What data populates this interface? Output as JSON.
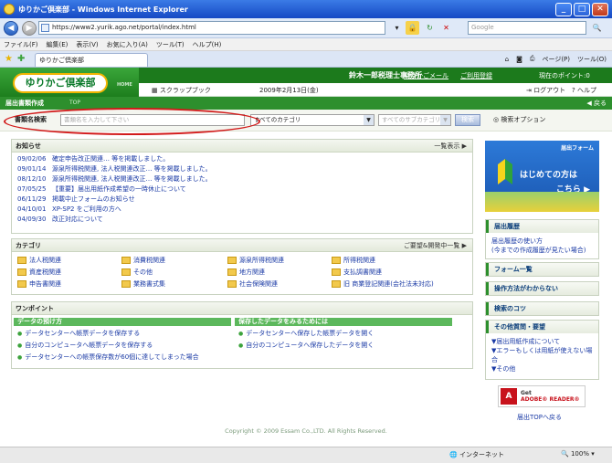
{
  "window": {
    "title": "ゆりかご倶楽部 - Windows Internet Explorer",
    "url": "https://www2.yurik.ago.net/portal/index.html",
    "search_placeholder": "Google"
  },
  "menu": [
    "ファイル(F)",
    "編集(E)",
    "表示(V)",
    "お気に入り(A)",
    "ツール(T)",
    "ヘルプ(H)"
  ],
  "tab": {
    "label": "ゆりかご倶楽部"
  },
  "commandbar": {
    "page": "ページ(P)",
    "tools": "ツール(O)"
  },
  "site": {
    "logo": "ゆりかご倶楽部",
    "home": "HOME",
    "office": "鈴木一郎税理士事務所",
    "mail": "ゆりかごメール",
    "register": "ご利用登録",
    "points": "現在のポイント:0",
    "scrapbook": "スクラップブック",
    "date": "2009年2月13日(金)",
    "logout": "ログアウト",
    "help": "ヘルプ"
  },
  "subbar": {
    "title": "届出書類作成",
    "crumb": "TOP",
    "back": "戻る"
  },
  "search": {
    "label": "書類名検索",
    "placeholder": "書類名を入力して下さい",
    "category": "すべてのカテゴリ",
    "subcategory": "すべてのサブカテゴリ",
    "button": "検索",
    "options": "検索オプション"
  },
  "news": {
    "title": "お知らせ",
    "more": "一覧表示",
    "items": [
      {
        "date": "09/02/06",
        "text": "確定申告改正関連… 等を掲載しました。"
      },
      {
        "date": "09/01/14",
        "text": "源泉所得税関連, 法人税関連改正… 等を掲載しました。"
      },
      {
        "date": "08/12/10",
        "text": "源泉所得税関連, 法人税関連改正… 等を掲載しました。"
      },
      {
        "date": "07/05/25",
        "text": "【重要】届出用紙作成希望の一時休止について"
      },
      {
        "date": "06/11/29",
        "text": "掲載中止フォームのお知らせ"
      },
      {
        "date": "04/10/01",
        "text": "XP-SP2 をご利用の方へ"
      },
      {
        "date": "04/09/30",
        "text": "改正対応について"
      }
    ]
  },
  "category": {
    "title": "カテゴリ",
    "more": "ご要望&開発中一覧",
    "items": [
      "法人税関連",
      "消費税関連",
      "源泉所得税関連",
      "所得税関連",
      "資産税関連",
      "その他",
      "地方関連",
      "支払調書関連",
      "申告書関連",
      "業務書式集",
      "社会保険関連",
      "旧 商業登記関連(会社法未対応)"
    ]
  },
  "onepoint": {
    "title": "ワンポイント",
    "left_title": "データの預け方",
    "left_items": [
      "データセンターへ帳票データを保存する",
      "自分のコンピュータへ帳票データを保存する",
      "データセンターへの帳票保存数が60個に達してしまった場合"
    ],
    "right_title": "保存したデータをみるためには",
    "right_items": [
      "データセンターへ保存した帳票データを開く",
      "自分のコンピュータへ保存したデータを開く"
    ]
  },
  "sidebar": {
    "banner_label": "届出フォーム",
    "banner_line1": "はじめての方は",
    "banner_line2": "こちら",
    "history_title": "届出履歴",
    "history_link1": "届出履歴の使い方",
    "history_link2": "(今までの作成履歴が見たい場合)",
    "forms": "フォーム一覧",
    "howto": "操作方法がわからない",
    "tips": "検索のコツ",
    "faq_title": "その他質問・要望",
    "faq_items": [
      "▼届出用紙作成について",
      "▼エラーもしくは用紙が使えない場合",
      "▼その他"
    ],
    "adobe_get": "Get",
    "adobe_reader": "ADOBE® READER®",
    "back_top": "届出TOPへ戻る"
  },
  "footer": {
    "copyright": "Copyright © 2009 Essam Co.,LTD. All Rights Reserved."
  },
  "status": {
    "zone": "インターネット",
    "zoom": "100%"
  }
}
